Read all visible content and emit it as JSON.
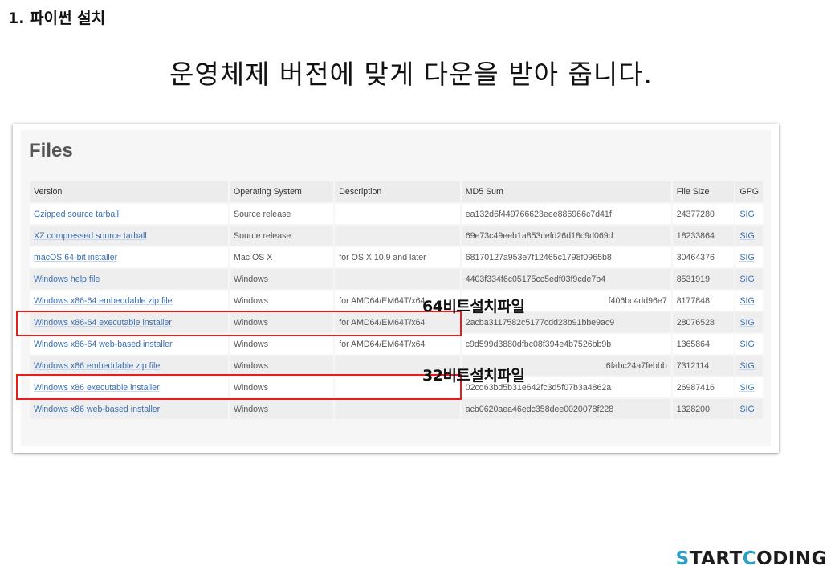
{
  "slide": {
    "heading": "1. 파이썬 설치",
    "subtitle": "운영체제 버전에 맞게 다운을 받아 줍니다."
  },
  "files_panel": {
    "title": "Files",
    "columns": [
      "Version",
      "Operating System",
      "Description",
      "MD5 Sum",
      "File Size",
      "GPG"
    ],
    "rows": [
      {
        "version": "Gzipped source tarball",
        "os": "Source release",
        "description": "",
        "md5": "ea132d6f449766623eee886966c7d41f",
        "size": "24377280",
        "gpg": "SIG"
      },
      {
        "version": "XZ compressed source tarball",
        "os": "Source release",
        "description": "",
        "md5": "69e73c49eeb1a853cefd26d18c9d069d",
        "size": "18233864",
        "gpg": "SIG"
      },
      {
        "version": "macOS 64-bit installer",
        "os": "Mac OS X",
        "description": "for OS X 10.9 and later",
        "md5": "68170127a953e7f12465c1798f0965b8",
        "size": "30464376",
        "gpg": "SIG"
      },
      {
        "version": "Windows help file",
        "os": "Windows",
        "description": "",
        "md5": "4403f334f6c05175cc5edf03f9cde7b4",
        "size": "8531919",
        "gpg": "SIG"
      },
      {
        "version": "Windows x86-64 embeddable zip file",
        "os": "Windows",
        "description": "for AMD64/EM64T/x64",
        "md5": "f406bc4dd96e7",
        "size": "8177848",
        "gpg": "SIG"
      },
      {
        "version": "Windows x86-64 executable installer",
        "os": "Windows",
        "description": "for AMD64/EM64T/x64",
        "md5": "2acba3117582c5177cdd28b91bbe9ac9",
        "size": "28076528",
        "gpg": "SIG"
      },
      {
        "version": "Windows x86-64 web-based installer",
        "os": "Windows",
        "description": "for AMD64/EM64T/x64",
        "md5": "c9d599d3880dfbc08f394e4b7526bb9b",
        "size": "1365864",
        "gpg": "SIG"
      },
      {
        "version": "Windows x86 embeddable zip file",
        "os": "Windows",
        "description": "",
        "md5": "6fabc24a7febbb",
        "size": "7312114",
        "gpg": "SIG"
      },
      {
        "version": "Windows x86 executable installer",
        "os": "Windows",
        "description": "",
        "md5": "02cd63bd5b31e642fc3d5f07b3a4862a",
        "size": "26987416",
        "gpg": "SIG"
      },
      {
        "version": "Windows x86 web-based installer",
        "os": "Windows",
        "description": "",
        "md5": "acb0620aea46edc358dee0020078f228",
        "size": "1328200",
        "gpg": "SIG"
      }
    ]
  },
  "annotations": {
    "label_64": "64비트설치파일",
    "label_32": "32비트설치파일",
    "highlight_color": "#e41e1e"
  },
  "brand": {
    "s": "S",
    "tart": "TART",
    "c": "C",
    "oding": "ODING",
    "accent_color": "#2b9fc4"
  }
}
